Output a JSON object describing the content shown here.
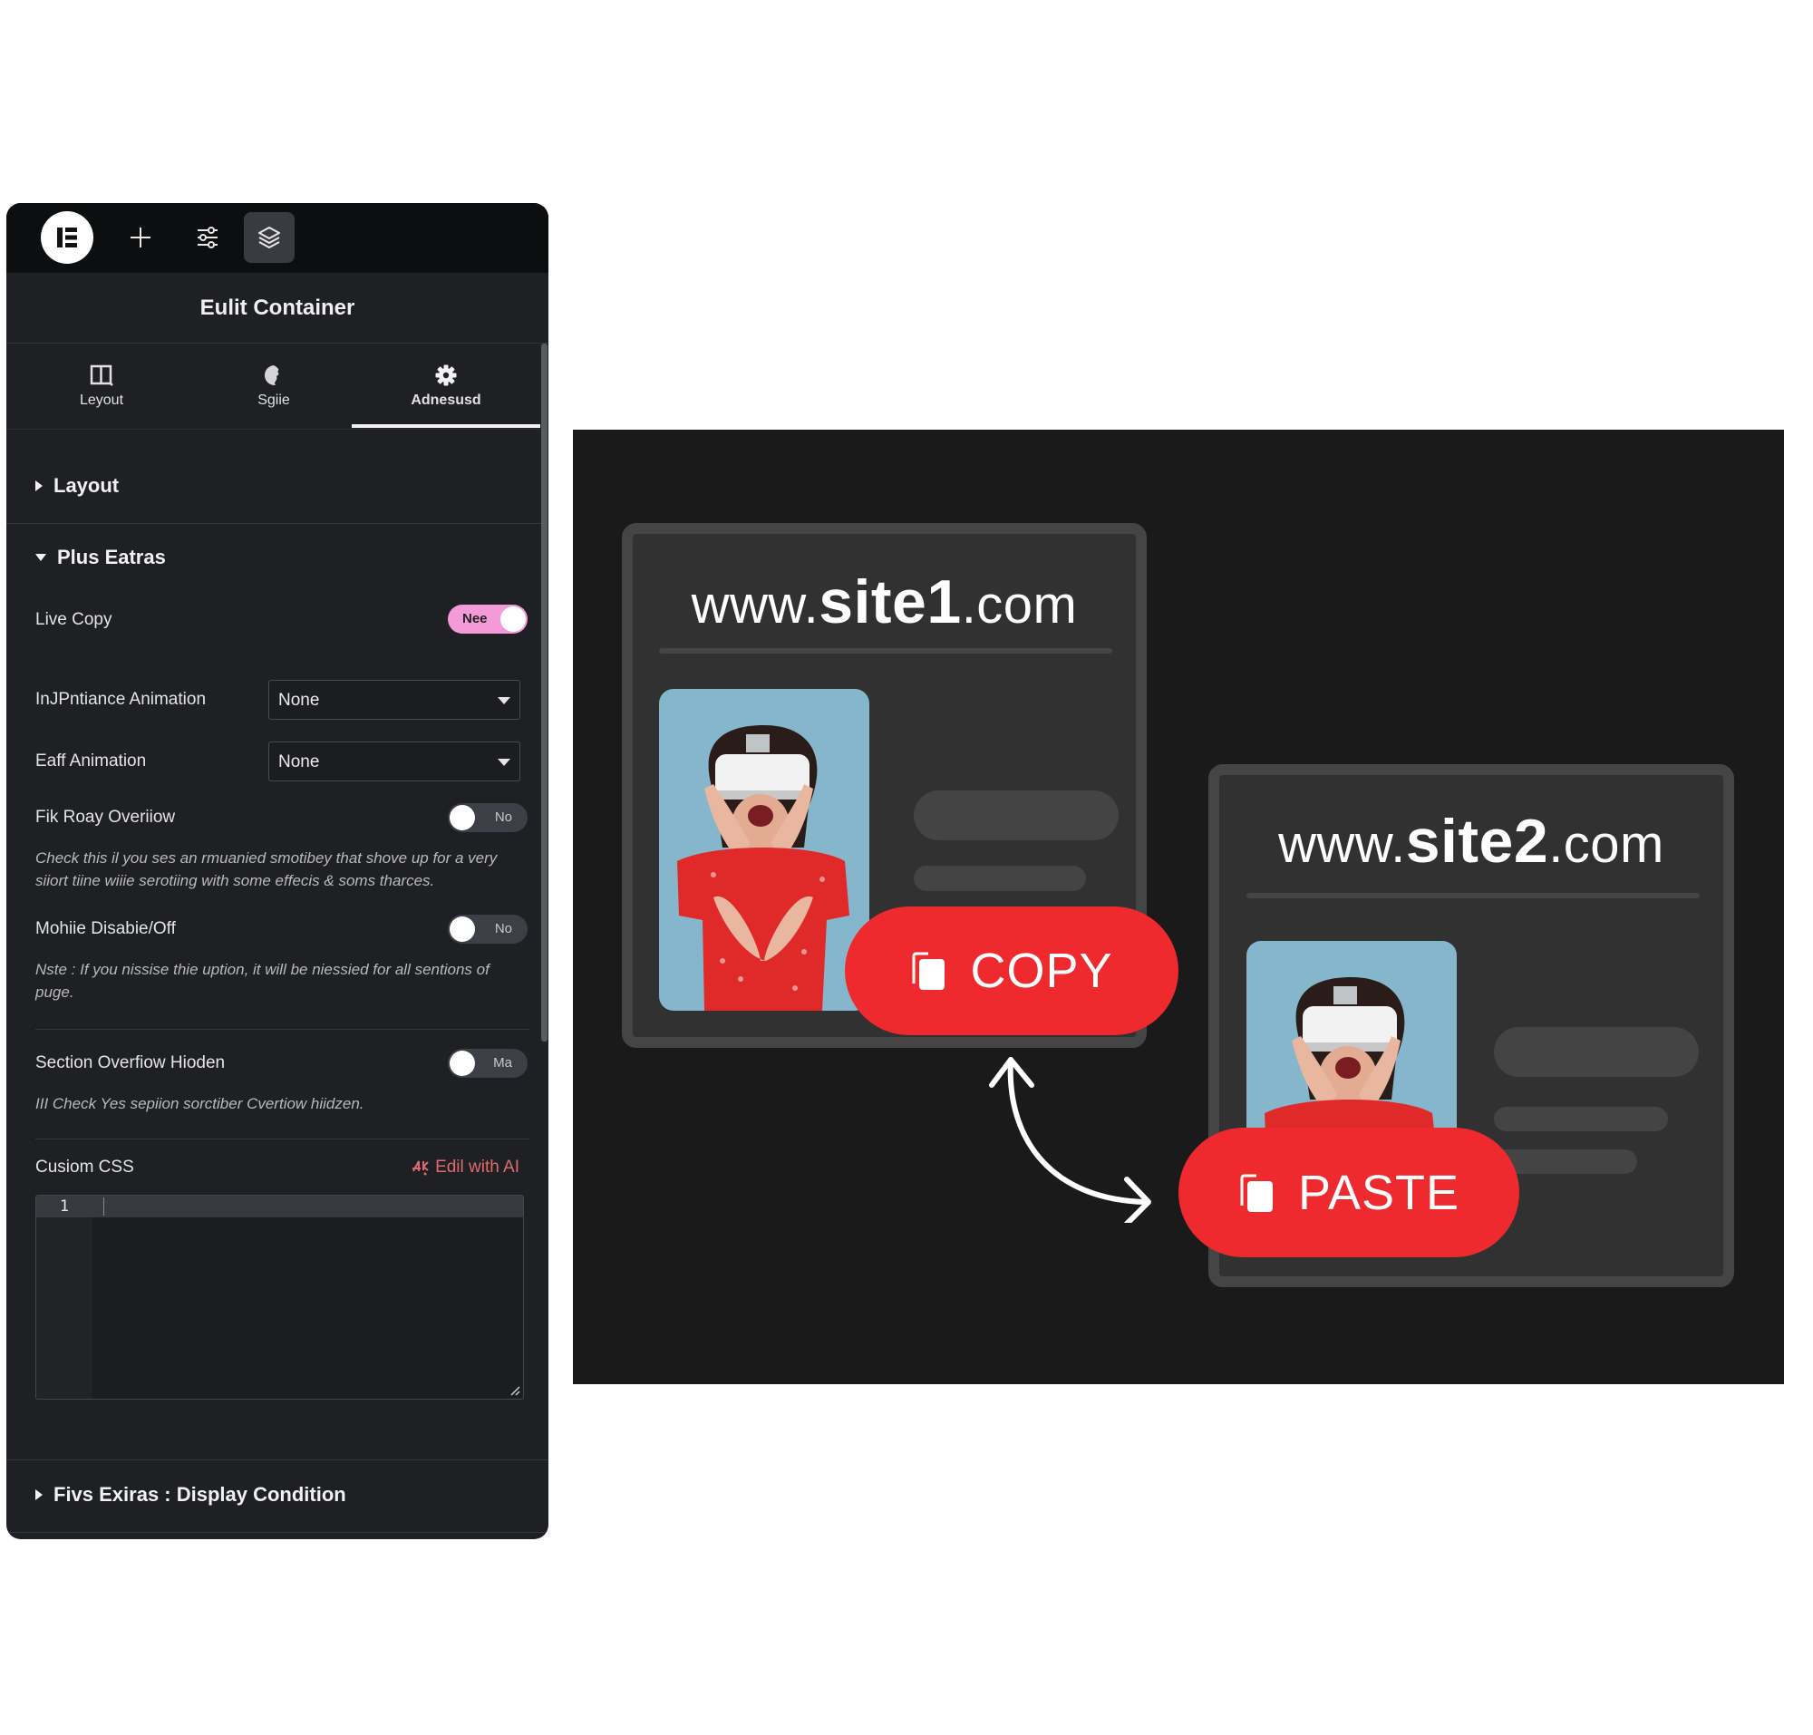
{
  "editor": {
    "toolbar": {
      "logo_icon": "elementor-logo-icon",
      "add_icon": "plus-icon",
      "settings_icon": "sliders-icon",
      "layers_icon": "layers-icon"
    },
    "title": "Eulit Container",
    "tabs": [
      {
        "label": "Leyout",
        "icon": "layout-columns-icon",
        "active": false
      },
      {
        "label": "Sgiie",
        "icon": "style-palette-icon",
        "active": false
      },
      {
        "label": "Adnesusd",
        "icon": "gear-icon",
        "active": true
      }
    ],
    "sections": {
      "layout": {
        "label": "Layout",
        "expanded": false
      },
      "plus_extras": {
        "label": "Plus Eatras",
        "expanded": true
      },
      "display_condition": {
        "label": "Fivs Exiras : Display Condition",
        "expanded": false
      }
    },
    "fields": {
      "live_copy": {
        "label": "Live Copy",
        "toggle_text": "Nee",
        "on": true
      },
      "entrance_animation": {
        "label": "InJPntiance Animation",
        "value": "None"
      },
      "exit_animation": {
        "label": "Eaff Animation",
        "value": "None"
      },
      "fix_body_overflow": {
        "label": "Fik Roay Overiiow",
        "toggle_text": "No",
        "on": false,
        "description": "Check this il you ses an rmuanied smotibey that shove up for a very siiort tiine wiiie serotiing with some effecis & soms tharces."
      },
      "mobile_disable": {
        "label": "Mohiie Disabie/Off",
        "toggle_text": "No",
        "on": false,
        "note": "Nste : If you nissise thie uption, it will be niessied for all sentions of puge."
      },
      "section_overflow": {
        "label": "Section Overfiow Hioden",
        "toggle_text": "Ma",
        "on": false,
        "description": "III Check Yes sepiion sorctiber Cvertiow hiidzen."
      },
      "custom_css": {
        "label": "Cusiom CSS",
        "ai_link": "Edil with AI",
        "ai_icon": "ai-sparkle-icon",
        "line_numbers": [
          "1"
        ],
        "value": ""
      }
    }
  },
  "illustration": {
    "site1": {
      "prefix": "www.",
      "name": "site1",
      "suffix": ".com"
    },
    "site2": {
      "prefix": "www.",
      "name": "site2",
      "suffix": ".com"
    },
    "copy_button": {
      "label": "COPY",
      "icon": "copy-icon"
    },
    "paste_button": {
      "label": "PASTE",
      "icon": "copy-icon"
    },
    "arrow_icon": "bidirectional-curved-arrow-icon",
    "colors": {
      "accent_red": "#ee2a2e",
      "toggle_pink": "#f49ad8",
      "ai_link_red": "#e06a6e",
      "photo_bg": "#86b6cc"
    }
  }
}
